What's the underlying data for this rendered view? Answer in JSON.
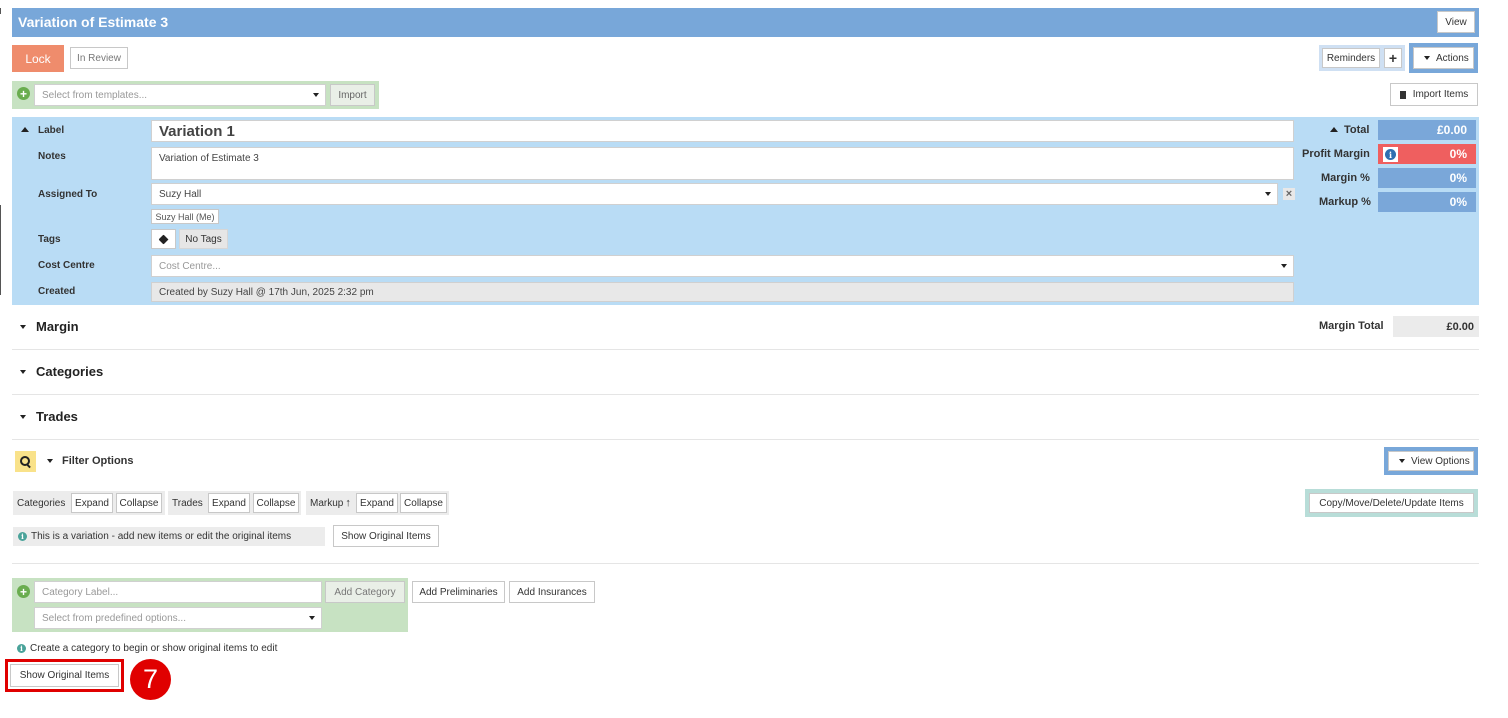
{
  "header": {
    "title": "Variation of Estimate 3",
    "view_label": "View"
  },
  "toolbar": {
    "lock_label": "Lock",
    "in_review_label": "In Review",
    "reminders_label": "Reminders",
    "reminders_add": "+",
    "actions_label": "Actions",
    "template_placeholder": "Select from templates...",
    "import_label": "Import",
    "import_items_label": "Import Items"
  },
  "details": {
    "label_label": "Label",
    "label_value": "Variation 1",
    "notes_label": "Notes",
    "notes_value": "Variation of Estimate 3",
    "assigned_label": "Assigned To",
    "assigned_value": "Suzy Hall",
    "assigned_me": "Suzy Hall (Me)",
    "clear_glyph": "×",
    "tags_label": "Tags",
    "no_tags": "No Tags",
    "cost_centre_label": "Cost Centre",
    "cost_centre_placeholder": "Cost Centre...",
    "created_label": "Created",
    "created_value": "Created by Suzy Hall @ 17th Jun, 2025 2:32 pm"
  },
  "totals": {
    "total_label": "Total",
    "total_value": "£0.00",
    "profit_margin_label": "Profit Margin",
    "profit_margin_value": "0%",
    "margin_pct_label": "Margin %",
    "margin_pct_value": "0%",
    "markup_pct_label": "Markup %",
    "markup_pct_value": "0%",
    "info_glyph": "i"
  },
  "sections": {
    "margin": "Margin",
    "margin_total_label": "Margin Total",
    "margin_total_value": "£0.00",
    "categories": "Categories",
    "trades": "Trades",
    "filter_options": "Filter Options",
    "view_options": "View Options"
  },
  "filters": {
    "categories_label": "Categories",
    "trades_label": "Trades",
    "markup_label": "Markup",
    "expand": "Expand",
    "collapse": "Collapse",
    "copy_move_label": "Copy/Move/Delete/Update Items"
  },
  "variation": {
    "info_text": "This is a variation - add new items or edit the original items",
    "show_original_label": "Show Original Items"
  },
  "add_category": {
    "label_placeholder": "Category Label...",
    "add_label": "Add Category",
    "predefined_placeholder": "Select from predefined options...",
    "preliminaries_label": "Add Preliminaries",
    "insurances_label": "Add Insurances",
    "hint_text": "Create a category to begin or show original items to edit",
    "show_original_label": "Show Original Items"
  },
  "annotation": {
    "step_number": "7"
  },
  "colors": {
    "header_bg": "#78a7d9",
    "details_bg": "#b9dcf5",
    "lock_bg": "#ef8c6c",
    "green_panel": "#c7e2c2",
    "total_bg": "#7aa7d9",
    "profit_bg": "#ef5f5f",
    "highlight_red": "#e00000"
  }
}
